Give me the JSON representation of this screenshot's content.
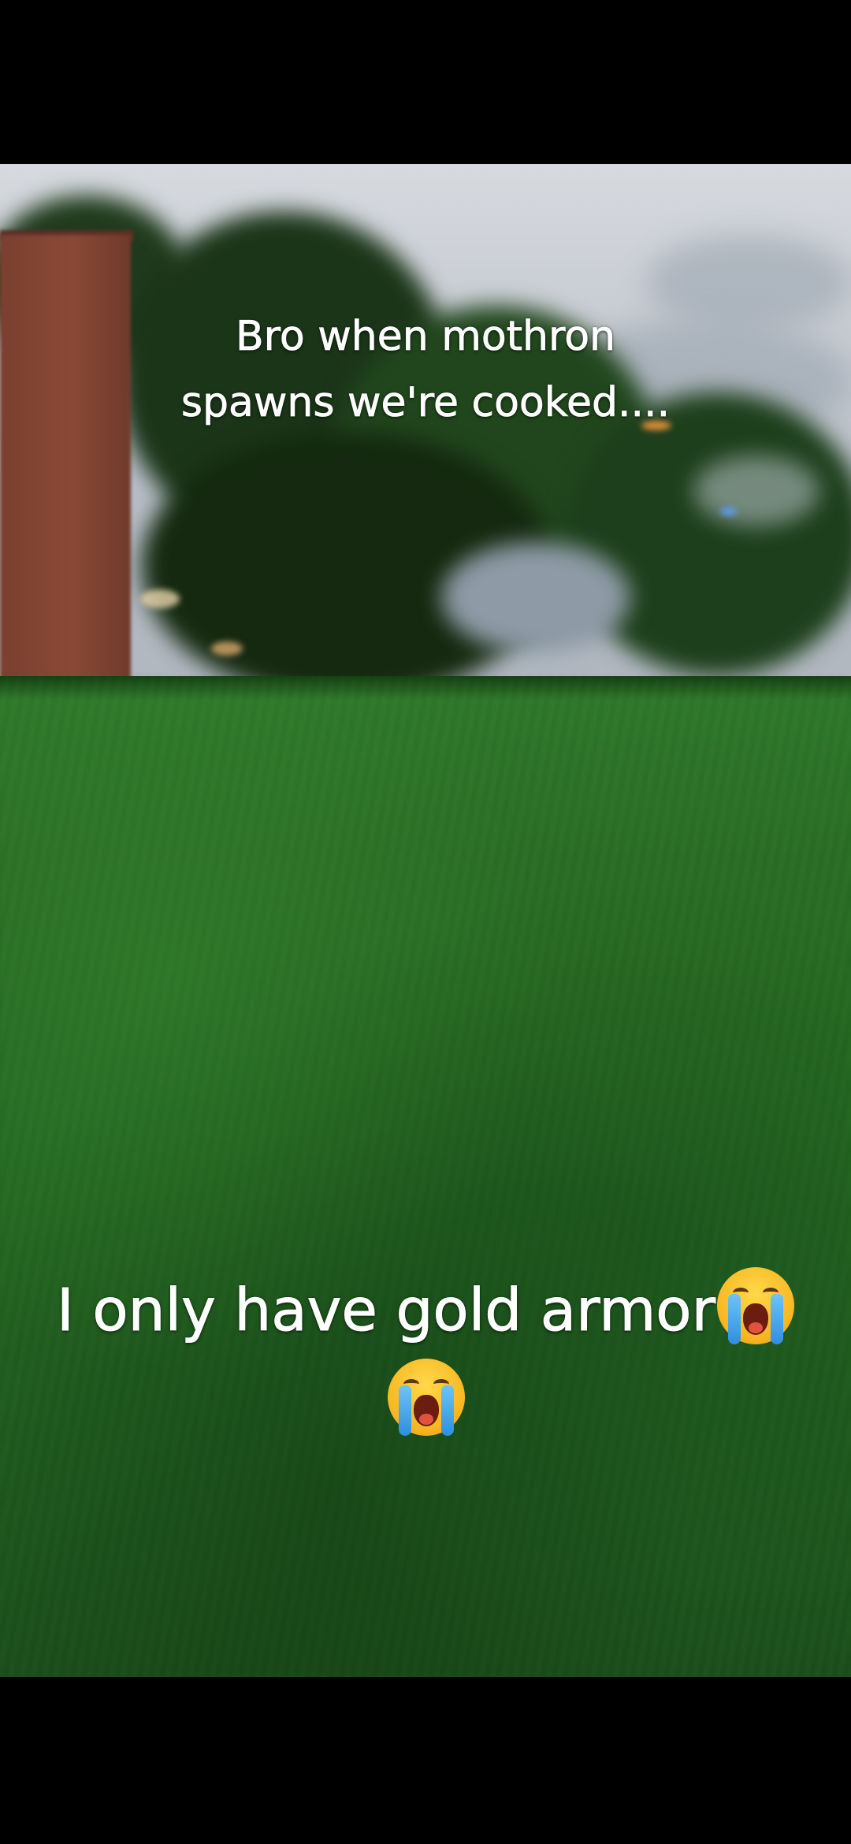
{
  "captions": {
    "top_line_1": "Bro when mothron",
    "top_line_2": "spawns we're cooked....",
    "bottom_line_1": "I only have gold armor"
  },
  "icons": {
    "caption_emoji": "loudly-crying-face-icon"
  },
  "colors": {
    "caption_text": "#ffffff",
    "letterbox": "#000000",
    "grass": "#2a6e24",
    "sky": "#c4c9d0",
    "brick": "#8a4935"
  }
}
